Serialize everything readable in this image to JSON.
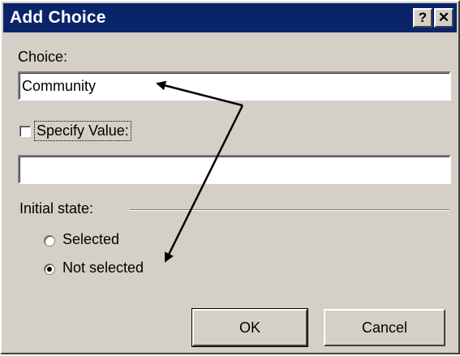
{
  "window": {
    "title": "Add Choice",
    "help_label": "?",
    "close_label": "✕"
  },
  "choice": {
    "label": "Choice:",
    "value": "Community"
  },
  "specify_value": {
    "label": "Specify Value:",
    "checked": false,
    "value": ""
  },
  "initial_state": {
    "label": "Initial state:",
    "options": [
      {
        "label": "Selected",
        "selected": false
      },
      {
        "label": "Not selected",
        "selected": true
      }
    ]
  },
  "buttons": {
    "ok": "OK",
    "cancel": "Cancel"
  },
  "annotation": {
    "color": "#000000"
  }
}
